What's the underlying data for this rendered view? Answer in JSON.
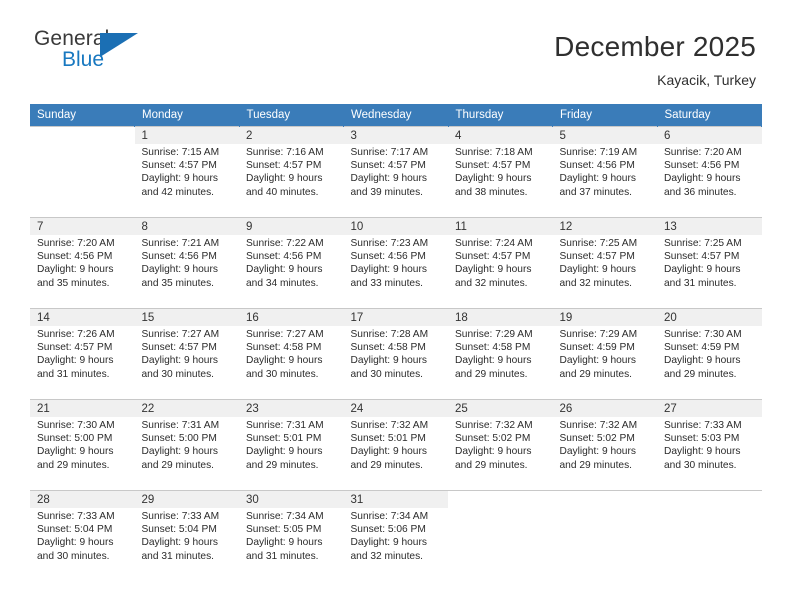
{
  "brand": {
    "name_part1": "General",
    "name_part2": "Blue"
  },
  "header": {
    "title": "December 2025",
    "subtitle": "Kayacik, Turkey"
  },
  "colors": {
    "header_blue": "#3a7cb9",
    "brand_blue": "#1878c0",
    "daynum_bg": "#f0f0f0",
    "grid_line": "#c8c8c8"
  },
  "weekdays": [
    "Sunday",
    "Monday",
    "Tuesday",
    "Wednesday",
    "Thursday",
    "Friday",
    "Saturday"
  ],
  "weeks": [
    [
      {
        "day": "",
        "sunrise": "",
        "sunset": "",
        "daylight1": "",
        "daylight2": ""
      },
      {
        "day": "1",
        "sunrise": "Sunrise: 7:15 AM",
        "sunset": "Sunset: 4:57 PM",
        "daylight1": "Daylight: 9 hours",
        "daylight2": "and 42 minutes."
      },
      {
        "day": "2",
        "sunrise": "Sunrise: 7:16 AM",
        "sunset": "Sunset: 4:57 PM",
        "daylight1": "Daylight: 9 hours",
        "daylight2": "and 40 minutes."
      },
      {
        "day": "3",
        "sunrise": "Sunrise: 7:17 AM",
        "sunset": "Sunset: 4:57 PM",
        "daylight1": "Daylight: 9 hours",
        "daylight2": "and 39 minutes."
      },
      {
        "day": "4",
        "sunrise": "Sunrise: 7:18 AM",
        "sunset": "Sunset: 4:57 PM",
        "daylight1": "Daylight: 9 hours",
        "daylight2": "and 38 minutes."
      },
      {
        "day": "5",
        "sunrise": "Sunrise: 7:19 AM",
        "sunset": "Sunset: 4:56 PM",
        "daylight1": "Daylight: 9 hours",
        "daylight2": "and 37 minutes."
      },
      {
        "day": "6",
        "sunrise": "Sunrise: 7:20 AM",
        "sunset": "Sunset: 4:56 PM",
        "daylight1": "Daylight: 9 hours",
        "daylight2": "and 36 minutes."
      }
    ],
    [
      {
        "day": "7",
        "sunrise": "Sunrise: 7:20 AM",
        "sunset": "Sunset: 4:56 PM",
        "daylight1": "Daylight: 9 hours",
        "daylight2": "and 35 minutes."
      },
      {
        "day": "8",
        "sunrise": "Sunrise: 7:21 AM",
        "sunset": "Sunset: 4:56 PM",
        "daylight1": "Daylight: 9 hours",
        "daylight2": "and 35 minutes."
      },
      {
        "day": "9",
        "sunrise": "Sunrise: 7:22 AM",
        "sunset": "Sunset: 4:56 PM",
        "daylight1": "Daylight: 9 hours",
        "daylight2": "and 34 minutes."
      },
      {
        "day": "10",
        "sunrise": "Sunrise: 7:23 AM",
        "sunset": "Sunset: 4:56 PM",
        "daylight1": "Daylight: 9 hours",
        "daylight2": "and 33 minutes."
      },
      {
        "day": "11",
        "sunrise": "Sunrise: 7:24 AM",
        "sunset": "Sunset: 4:57 PM",
        "daylight1": "Daylight: 9 hours",
        "daylight2": "and 32 minutes."
      },
      {
        "day": "12",
        "sunrise": "Sunrise: 7:25 AM",
        "sunset": "Sunset: 4:57 PM",
        "daylight1": "Daylight: 9 hours",
        "daylight2": "and 32 minutes."
      },
      {
        "day": "13",
        "sunrise": "Sunrise: 7:25 AM",
        "sunset": "Sunset: 4:57 PM",
        "daylight1": "Daylight: 9 hours",
        "daylight2": "and 31 minutes."
      }
    ],
    [
      {
        "day": "14",
        "sunrise": "Sunrise: 7:26 AM",
        "sunset": "Sunset: 4:57 PM",
        "daylight1": "Daylight: 9 hours",
        "daylight2": "and 31 minutes."
      },
      {
        "day": "15",
        "sunrise": "Sunrise: 7:27 AM",
        "sunset": "Sunset: 4:57 PM",
        "daylight1": "Daylight: 9 hours",
        "daylight2": "and 30 minutes."
      },
      {
        "day": "16",
        "sunrise": "Sunrise: 7:27 AM",
        "sunset": "Sunset: 4:58 PM",
        "daylight1": "Daylight: 9 hours",
        "daylight2": "and 30 minutes."
      },
      {
        "day": "17",
        "sunrise": "Sunrise: 7:28 AM",
        "sunset": "Sunset: 4:58 PM",
        "daylight1": "Daylight: 9 hours",
        "daylight2": "and 30 minutes."
      },
      {
        "day": "18",
        "sunrise": "Sunrise: 7:29 AM",
        "sunset": "Sunset: 4:58 PM",
        "daylight1": "Daylight: 9 hours",
        "daylight2": "and 29 minutes."
      },
      {
        "day": "19",
        "sunrise": "Sunrise: 7:29 AM",
        "sunset": "Sunset: 4:59 PM",
        "daylight1": "Daylight: 9 hours",
        "daylight2": "and 29 minutes."
      },
      {
        "day": "20",
        "sunrise": "Sunrise: 7:30 AM",
        "sunset": "Sunset: 4:59 PM",
        "daylight1": "Daylight: 9 hours",
        "daylight2": "and 29 minutes."
      }
    ],
    [
      {
        "day": "21",
        "sunrise": "Sunrise: 7:30 AM",
        "sunset": "Sunset: 5:00 PM",
        "daylight1": "Daylight: 9 hours",
        "daylight2": "and 29 minutes."
      },
      {
        "day": "22",
        "sunrise": "Sunrise: 7:31 AM",
        "sunset": "Sunset: 5:00 PM",
        "daylight1": "Daylight: 9 hours",
        "daylight2": "and 29 minutes."
      },
      {
        "day": "23",
        "sunrise": "Sunrise: 7:31 AM",
        "sunset": "Sunset: 5:01 PM",
        "daylight1": "Daylight: 9 hours",
        "daylight2": "and 29 minutes."
      },
      {
        "day": "24",
        "sunrise": "Sunrise: 7:32 AM",
        "sunset": "Sunset: 5:01 PM",
        "daylight1": "Daylight: 9 hours",
        "daylight2": "and 29 minutes."
      },
      {
        "day": "25",
        "sunrise": "Sunrise: 7:32 AM",
        "sunset": "Sunset: 5:02 PM",
        "daylight1": "Daylight: 9 hours",
        "daylight2": "and 29 minutes."
      },
      {
        "day": "26",
        "sunrise": "Sunrise: 7:32 AM",
        "sunset": "Sunset: 5:02 PM",
        "daylight1": "Daylight: 9 hours",
        "daylight2": "and 29 minutes."
      },
      {
        "day": "27",
        "sunrise": "Sunrise: 7:33 AM",
        "sunset": "Sunset: 5:03 PM",
        "daylight1": "Daylight: 9 hours",
        "daylight2": "and 30 minutes."
      }
    ],
    [
      {
        "day": "28",
        "sunrise": "Sunrise: 7:33 AM",
        "sunset": "Sunset: 5:04 PM",
        "daylight1": "Daylight: 9 hours",
        "daylight2": "and 30 minutes."
      },
      {
        "day": "29",
        "sunrise": "Sunrise: 7:33 AM",
        "sunset": "Sunset: 5:04 PM",
        "daylight1": "Daylight: 9 hours",
        "daylight2": "and 31 minutes."
      },
      {
        "day": "30",
        "sunrise": "Sunrise: 7:34 AM",
        "sunset": "Sunset: 5:05 PM",
        "daylight1": "Daylight: 9 hours",
        "daylight2": "and 31 minutes."
      },
      {
        "day": "31",
        "sunrise": "Sunrise: 7:34 AM",
        "sunset": "Sunset: 5:06 PM",
        "daylight1": "Daylight: 9 hours",
        "daylight2": "and 32 minutes."
      },
      {
        "day": "",
        "sunrise": "",
        "sunset": "",
        "daylight1": "",
        "daylight2": ""
      },
      {
        "day": "",
        "sunrise": "",
        "sunset": "",
        "daylight1": "",
        "daylight2": ""
      },
      {
        "day": "",
        "sunrise": "",
        "sunset": "",
        "daylight1": "",
        "daylight2": ""
      }
    ]
  ]
}
